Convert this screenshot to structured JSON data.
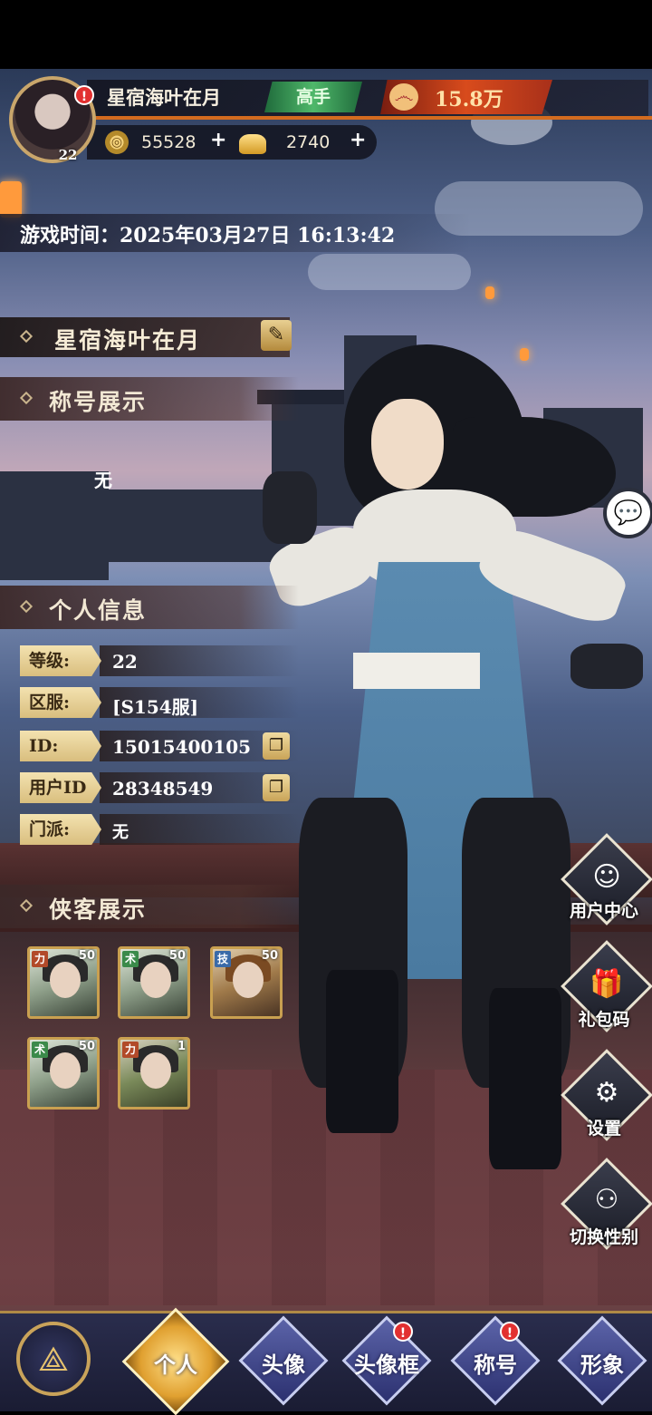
{
  "player": {
    "name": "星宿海叶在月",
    "level": "22",
    "rank": "高手",
    "power": "15.8万",
    "coins": "55528",
    "ingots": "2740",
    "alert": "!"
  },
  "game_time": "游戏时间：2025年03月27日 16:13:42",
  "name_section": {
    "name": "星宿海叶在月"
  },
  "title_section": {
    "header": "称号展示",
    "value": "无"
  },
  "info_section": {
    "header": "个人信息",
    "rows": [
      {
        "label": "等级:",
        "value": "22"
      },
      {
        "label": "区服:",
        "value": "[S154服]"
      },
      {
        "label": "ID:",
        "value": "15015400105"
      },
      {
        "label": "用户ID",
        "value": "28348549"
      },
      {
        "label": "门派:",
        "value": "无"
      }
    ]
  },
  "heroes_section": {
    "header": "侠客展示",
    "heroes": [
      {
        "tag": "力",
        "level": "50",
        "tag_color": "#b24a2a"
      },
      {
        "tag": "术",
        "level": "50",
        "tag_color": "#3b8a4a"
      },
      {
        "tag": "技",
        "level": "50",
        "tag_color": "#3a6aa8"
      },
      {
        "tag": "术",
        "level": "50",
        "tag_color": "#3b8a4a"
      },
      {
        "tag": "力",
        "level": "1",
        "tag_color": "#b24a2a"
      }
    ]
  },
  "side_buttons": [
    {
      "label": "用户中心",
      "icon": "user-icon"
    },
    {
      "label": "礼包码",
      "icon": "gift-icon"
    },
    {
      "label": "设置",
      "icon": "gear-icon"
    },
    {
      "label": "切换性别",
      "icon": "gender-switch-icon"
    }
  ],
  "bottom_nav": [
    {
      "label": "个人",
      "active": true,
      "alert": false
    },
    {
      "label": "头像",
      "active": false,
      "alert": false
    },
    {
      "label": "头像框",
      "active": false,
      "alert": true
    },
    {
      "label": "称号",
      "active": false,
      "alert": true
    },
    {
      "label": "形象",
      "active": false,
      "alert": false
    }
  ],
  "colors": {
    "accent_gold": "#c9a35a",
    "power_red": "#d84b1c",
    "rank_green": "#4fb86a",
    "alert_red": "#e23030"
  }
}
